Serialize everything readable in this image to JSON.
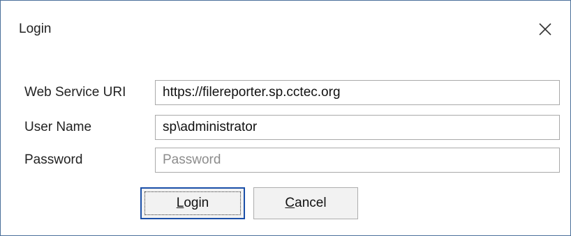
{
  "window": {
    "title": "Login"
  },
  "icons": {
    "close": "close-icon"
  },
  "fields": {
    "uri": {
      "label": "Web Service URI",
      "value": "https://filereporter.sp.cctec.org"
    },
    "username": {
      "label": "User Name",
      "value": "sp\\administrator"
    },
    "password": {
      "label": "Password",
      "value": "",
      "placeholder": "Password"
    }
  },
  "buttons": {
    "login": {
      "mnemonic": "L",
      "rest": "ogin"
    },
    "cancel": {
      "mnemonic": "C",
      "rest": "ancel"
    }
  },
  "colors": {
    "focus_border": "#1a4fa8",
    "window_border": "#4a6f9a",
    "button_face": "#f2f2f2"
  }
}
